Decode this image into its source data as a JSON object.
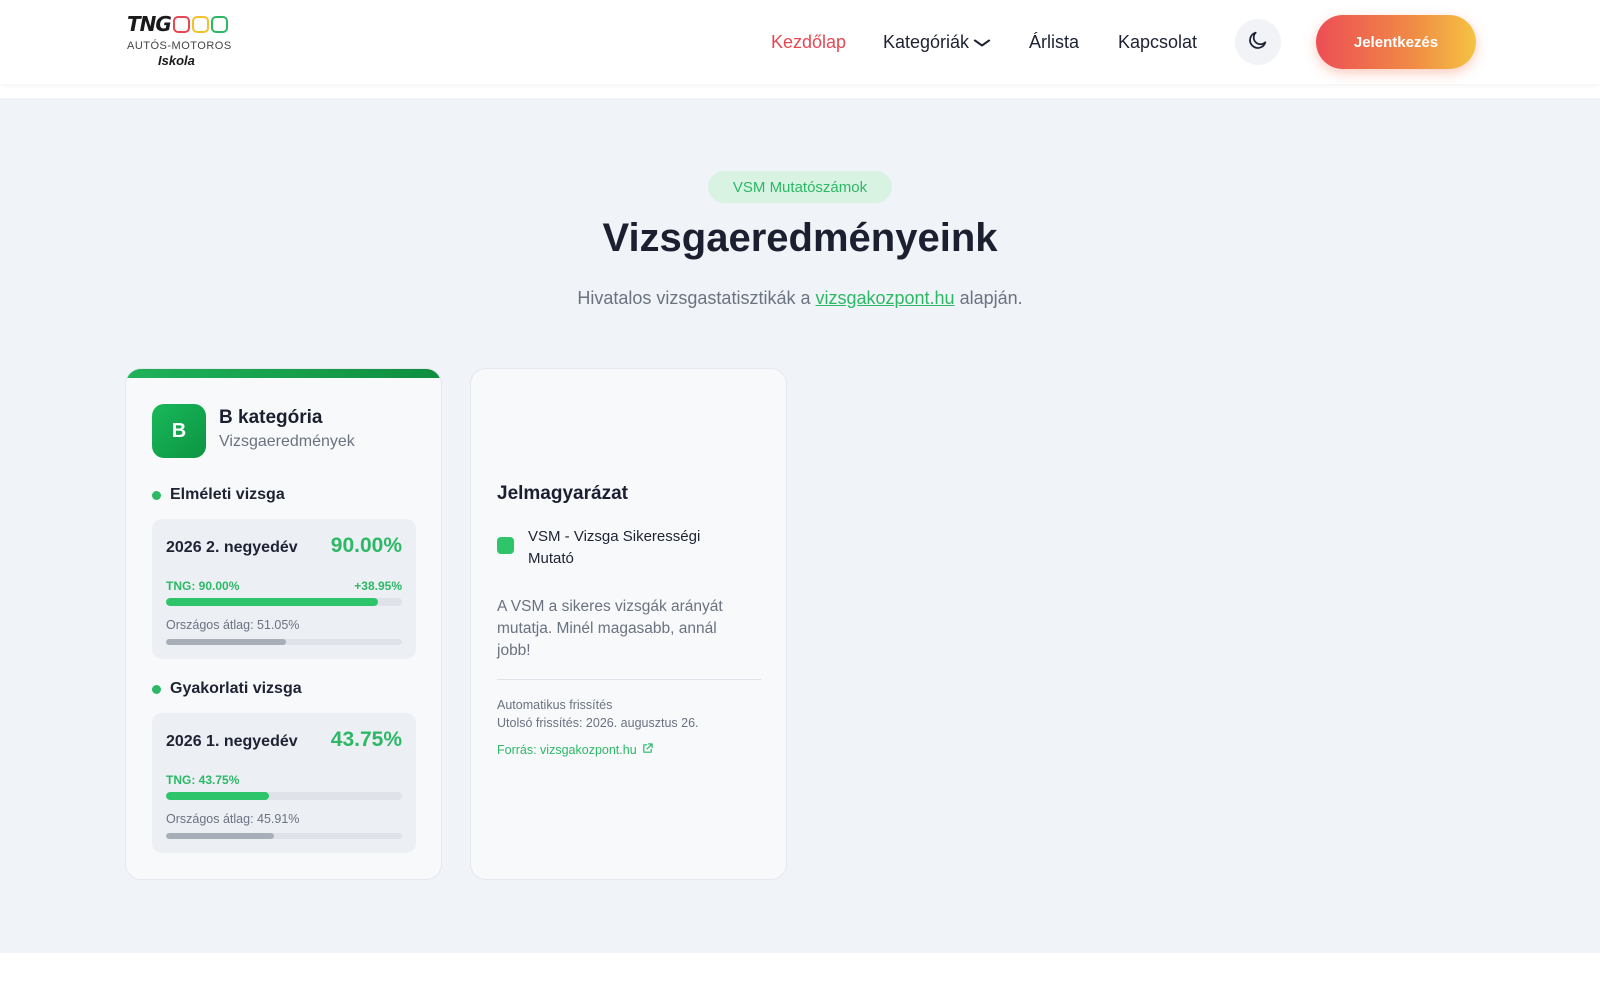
{
  "header": {
    "logo": {
      "word": "TNG",
      "sub": "AUTÓS-MOTOROS",
      "sub2": "Iskola",
      "ring_colors": [
        "#e54852",
        "#f2c12e",
        "#2db866"
      ]
    },
    "nav": [
      {
        "label": "Kezdőlap",
        "active": true
      },
      {
        "label": "Kategóriák",
        "has_dropdown": true
      },
      {
        "label": "Árlista"
      },
      {
        "label": "Kapcsolat"
      }
    ],
    "theme_icon": "moon-icon",
    "cta": "Jelentkezés"
  },
  "hero": {
    "pill": "VSM Mutatószámok",
    "title": "Vizsgaeredményeink",
    "subtitle_pre": "Hivatalos vizsgastatisztikák a ",
    "subtitle_link": "vizsgakozpont.hu",
    "subtitle_post": " alapján."
  },
  "category_card": {
    "avatar": "B",
    "title": "B kategória",
    "subtitle": "Vizsgaeredmények",
    "sections": [
      {
        "heading": "Elméleti vizsga",
        "quarter": "2026 2. negyedév",
        "percent": "90.00%",
        "tng_label": "TNG: 90.00%",
        "diff": "+38.95%",
        "national_label": "Országos átlag: 51.05%",
        "tng_value": 90.0,
        "national_value": 51.05
      },
      {
        "heading": "Gyakorlati vizsga",
        "quarter": "2026 1. negyedév",
        "percent": "43.75%",
        "tng_label": "TNG: 43.75%",
        "diff": "",
        "national_label": "Országos átlag: 45.91%",
        "tng_value": 43.75,
        "national_value": 45.91
      }
    ]
  },
  "legend": {
    "title": "Jelmagyarázat",
    "item": "VSM - Vizsga Sikerességi Mutató",
    "description": "A VSM a sikeres vizsgák arányát mutatja. Minél magasabb, annál jobb!",
    "auto_update": "Automatikus frissítés",
    "last_update": "Utolsó frissítés: 2026. augusztus 26.",
    "source": "Forrás: vizsgakozpont.hu",
    "source_icon": "external-link-icon"
  },
  "colors": {
    "accent_green": "#2db866",
    "nav_active": "#e54852"
  }
}
